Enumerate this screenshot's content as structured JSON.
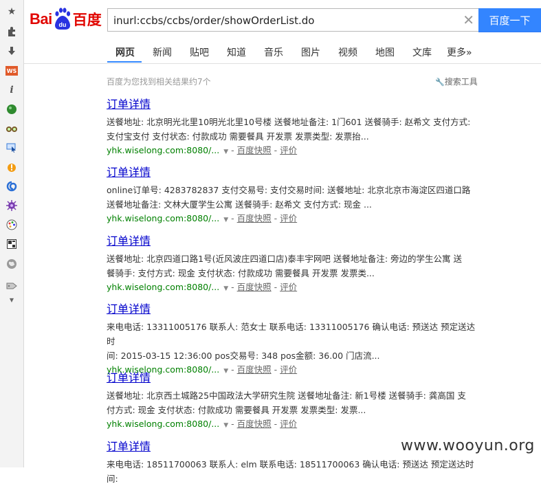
{
  "search": {
    "query": "inurl:ccbs/ccbs/order/showOrderList.do",
    "button_label": "百度一下"
  },
  "tabs": [
    "网页",
    "新闻",
    "贴吧",
    "知道",
    "音乐",
    "图片",
    "视频",
    "地图",
    "文库",
    "更多»"
  ],
  "results_count": "百度为您找到相关结果约7个",
  "tools_label": "搜索工具",
  "results": [
    {
      "title": "订单详情",
      "abs_line1": "送餐地址: 北京明光北里10明光北里10号楼 送餐地址备注: 1门601 送餐骑手: 赵希文 支付方式:",
      "abs_line2": "支付宝支付 支付状态: 付款成功 需要餐具 开发票 发票类型: 发票抬...",
      "url": "yhk.wiselong.com:8080/...",
      "snapshot": "百度快照",
      "rate": "评价"
    },
    {
      "title": "订单详情",
      "abs_line1": "online订单号: 4283782837 支付交易号: 支付交易时间: 送餐地址: 北京北京市海淀区四道口路",
      "abs_line2": "送餐地址备注: 文林大厦学生公寓 送餐骑手: 赵希文 支付方式: 现金 ...",
      "url": "yhk.wiselong.com:8080/...",
      "snapshot": "百度快照",
      "rate": "评价"
    },
    {
      "title": "订单详情",
      "abs_line1": "送餐地址: 北京四道口路1号(近风波庄四道口店)泰丰宇网吧 送餐地址备注: 旁边的学生公寓 送",
      "abs_line2": "餐骑手: 支付方式: 现金 支付状态: 付款成功 需要餐具 开发票 发票类...",
      "url": "yhk.wiselong.com:8080/...",
      "snapshot": "百度快照",
      "rate": "评价"
    },
    {
      "title": "订单详情",
      "abs_line1": "来电电话: 13311005176 联系人: 范女士 联系电话: 13311005176 确认电话: 预送达 预定送达时",
      "abs_line2": "间: 2015-03-15 12:36:00 pos交易号: 348 pos金额: 36.00 门店流...",
      "url": "yhk.wiselong.com:8080/...",
      "snapshot": "百度快照",
      "rate": "评价"
    },
    {
      "title": "订单详情",
      "abs_line1": "送餐地址: 北京西土城路25中国政法大学研究生院 送餐地址备注: 新1号楼 送餐骑手: 龚高国 支",
      "abs_line2": "付方式: 现金 支付状态: 付款成功 需要餐具 开发票 发票类型: 发票...",
      "url": "yhk.wiselong.com:8080/...",
      "snapshot": "百度快照",
      "rate": "评价"
    },
    {
      "title": "订单详情",
      "abs_line1": "来电电话: 18511700063 联系人: elm 联系电话: 18511700063 确认电话: 预送达 预定送达时间:",
      "abs_line2": "",
      "url": "",
      "snapshot": "",
      "rate": ""
    }
  ],
  "watermark": "www.wooyun.org",
  "colors": {
    "search_button": "#3385ff",
    "title_link": "#0000cc",
    "url_green": "#008000",
    "logo_red": "#e10601",
    "logo_blue": "#2932e1"
  },
  "sidebar_icons": [
    "star-icon",
    "puzzle-icon",
    "download-icon",
    "ws-icon",
    "info-icon",
    "globe-icon",
    "binoculars-icon",
    "pointer-icon",
    "flame-icon",
    "swirl-icon",
    "virus-icon",
    "palette-icon",
    "grid-icon",
    "earth-icon",
    "tag-icon",
    "chevron-down-icon"
  ]
}
